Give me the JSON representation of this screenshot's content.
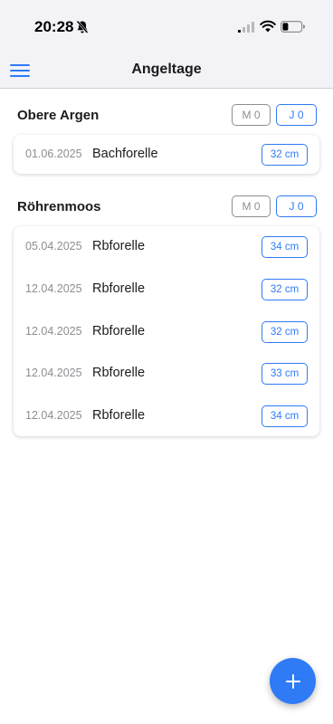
{
  "status_bar": {
    "time": "20:28"
  },
  "header": {
    "title": "Angeltage"
  },
  "sections": [
    {
      "title": "Obere Argen",
      "badge_m": "M 0",
      "badge_j": "J 0",
      "rows": [
        {
          "date": "01.06.2025",
          "species": "Bachforelle",
          "size": "32 cm"
        }
      ]
    },
    {
      "title": "Röhrenmoos",
      "badge_m": "M 0",
      "badge_j": "J 0",
      "rows": [
        {
          "date": "05.04.2025",
          "species": "Rbforelle",
          "size": "34 cm"
        },
        {
          "date": "12.04.2025",
          "species": "Rbforelle",
          "size": "32 cm"
        },
        {
          "date": "12.04.2025",
          "species": "Rbforelle",
          "size": "32 cm"
        },
        {
          "date": "12.04.2025",
          "species": "Rbforelle",
          "size": "33 cm"
        },
        {
          "date": "12.04.2025",
          "species": "Rbforelle",
          "size": "34 cm"
        }
      ]
    }
  ],
  "colors": {
    "accent": "#2f7bf5",
    "muted": "#8e8e93"
  },
  "icons": {
    "menu": "hamburger-icon",
    "add": "plus-icon",
    "bell": "bell-slash-icon",
    "signal": "cellular-signal-icon",
    "wifi": "wifi-icon",
    "battery": "battery-icon"
  }
}
